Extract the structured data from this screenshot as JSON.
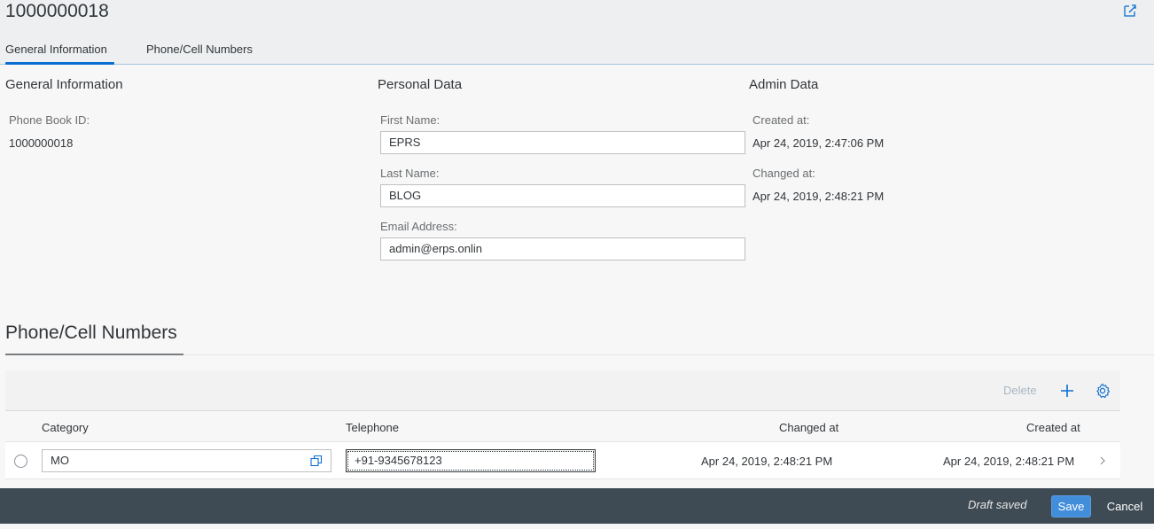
{
  "header": {
    "title": "1000000018",
    "share_icon": "share-icon"
  },
  "tabs": [
    {
      "label": "General Information",
      "active": true
    },
    {
      "label": "Phone/Cell Numbers",
      "active": false
    }
  ],
  "general_information": {
    "section_title": "General Information",
    "phone_book_id_label": "Phone Book ID:",
    "phone_book_id_value": "1000000018"
  },
  "personal_data": {
    "section_title": "Personal Data",
    "first_name_label": "First Name:",
    "first_name_value": "EPRS",
    "last_name_label": "Last Name:",
    "last_name_value": "BLOG",
    "email_label": "Email Address:",
    "email_value": "admin@erps.onlin"
  },
  "admin_data": {
    "section_title": "Admin Data",
    "created_at_label": "Created at:",
    "created_at_value": "Apr 24, 2019, 2:47:06 PM",
    "changed_at_label": "Changed at:",
    "changed_at_value": "Apr 24, 2019, 2:48:21 PM"
  },
  "phone_section": {
    "title": "Phone/Cell Numbers",
    "toolbar": {
      "delete_label": "Delete",
      "add_icon": "plus-icon",
      "settings_icon": "gear-icon"
    },
    "columns": [
      "Category",
      "Telephone",
      "Changed at",
      "Created at"
    ],
    "rows": [
      {
        "category": "MO",
        "telephone": "+91-9345678123",
        "changed_at": "Apr 24, 2019, 2:48:21 PM",
        "created_at": "Apr 24, 2019, 2:48:21 PM"
      }
    ]
  },
  "footer": {
    "status": "Draft saved",
    "save_label": "Save",
    "cancel_label": "Cancel"
  },
  "colors": {
    "accent": "#0a6ed1",
    "footer_bg": "#3f4b54",
    "save_button": "#428eda"
  }
}
